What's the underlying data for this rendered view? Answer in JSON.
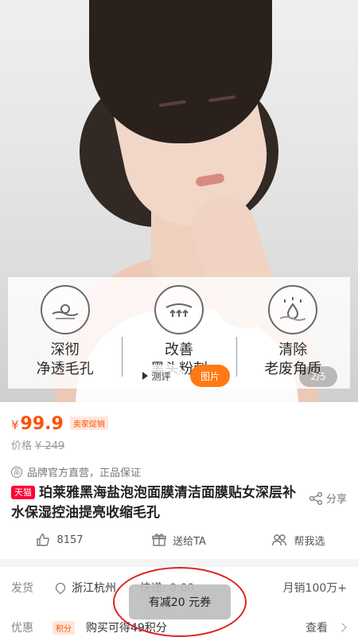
{
  "hero": {
    "features": [
      {
        "text": "深彻\n净透毛孔",
        "icon": "pore-icon"
      },
      {
        "text": "改善\n黑头粉刺",
        "icon": "skin-layer-icon"
      },
      {
        "text": "清除\n老废角质",
        "icon": "droplet-icon"
      }
    ],
    "video_label": "测评",
    "photo_label": "图片",
    "pager": "2/5"
  },
  "price": {
    "currency": "¥",
    "value": "99.9",
    "promo_tag": "卖家促销",
    "original_label": "价格",
    "original_value": "¥ 249"
  },
  "brand": {
    "text": "品牌官方直营，正品保证"
  },
  "product": {
    "store_tag": "天猫",
    "title": "珀莱雅黑海盐泡泡面膜清洁面膜贴女深层补水保湿控油提亮收缩毛孔",
    "share_label": "分享"
  },
  "actions": {
    "likes": "8157",
    "gift": "送给TA",
    "help": "帮我选"
  },
  "shipping": {
    "label": "发货",
    "location": "浙江杭州",
    "fee": "快递: 0.00",
    "sales": "月销100万+"
  },
  "promotion": {
    "label": "优惠",
    "points_tag": "积分",
    "points_text": "购买可得49积分",
    "view": "查看"
  },
  "toast": {
    "text": "有减20 元券"
  },
  "colors": {
    "accent": "#ff5000",
    "tmall": "#ff0036",
    "photo_button": "#ff7a14",
    "highlight_oval": "#dd2222"
  }
}
